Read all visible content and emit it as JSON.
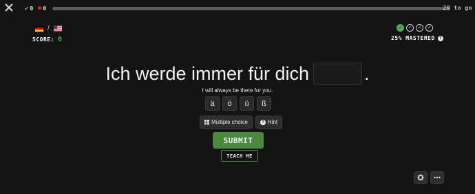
{
  "header": {
    "close_icon": "close-icon",
    "correct_count": "0",
    "wrong_count": "0",
    "progress_fraction": 0.0,
    "to_go_label": "20 to go"
  },
  "languages": {
    "from_flag": "german-flag",
    "to_flag": "us-flag",
    "separator": "/"
  },
  "score": {
    "label": "SCORE:",
    "value": "0"
  },
  "mastery": {
    "icons": [
      "done",
      "todo",
      "todo",
      "todo"
    ],
    "label": "25% MASTERED",
    "help_icon": "question-circle-icon"
  },
  "exercise": {
    "sentence_before": "Ich werde immer für dich",
    "blank_value": "",
    "sentence_after": ".",
    "translation": "I will always be there for you."
  },
  "special_chars": [
    "ä",
    "ö",
    "ü",
    "ß"
  ],
  "actions": {
    "multiple_choice": "Multiple choice",
    "hint": "Hint",
    "submit": "SUBMIT",
    "teach_me": "TEACH ME"
  },
  "corner": {
    "settings_icon": "gear-icon",
    "more_icon": "ellipsis-icon"
  },
  "colors": {
    "background": "#141414",
    "accent_green": "#4a8a3e",
    "correct_green": "#4caf50",
    "wrong_red": "#e53935"
  }
}
